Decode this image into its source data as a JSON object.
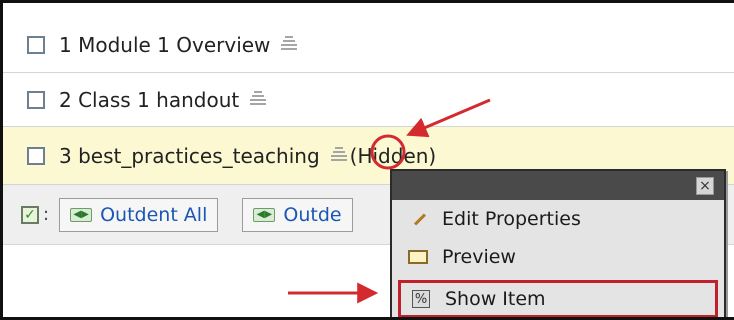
{
  "items": [
    {
      "number": "1",
      "title": "Module 1 Overview",
      "status": ""
    },
    {
      "number": "2",
      "title": "Class 1 handout",
      "status": ""
    },
    {
      "number": "3",
      "title": "best_practices_teaching",
      "status": "(Hidden)"
    }
  ],
  "toolbar": {
    "select_all_suffix": ":",
    "outdent_all_label": "Outdent All",
    "outdent_selected_label": "Outde"
  },
  "context_menu": {
    "close_glyph": "×",
    "items": [
      {
        "label": "Edit Properties",
        "icon": "pencil-icon"
      },
      {
        "label": "Preview",
        "icon": "preview-icon"
      },
      {
        "label": "Show Item",
        "icon": "show-item-icon",
        "highlighted": true
      }
    ]
  },
  "annotation_colors": {
    "arrow": "#d42a2f",
    "circle": "#d42a2f"
  }
}
